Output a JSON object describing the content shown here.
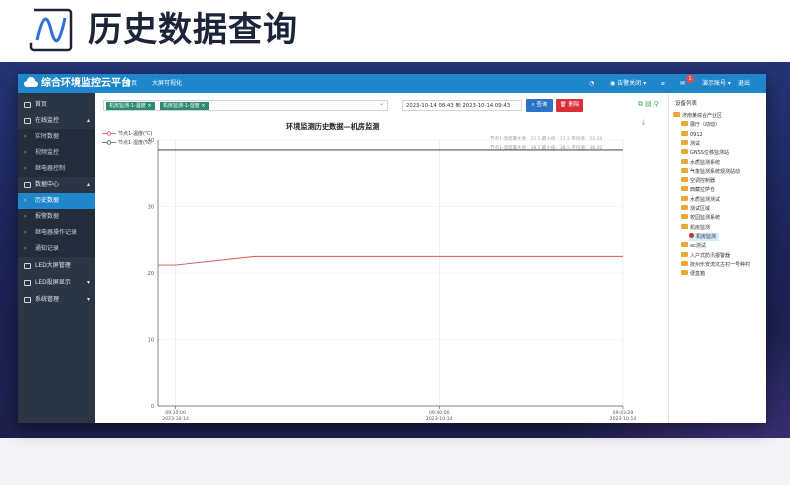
{
  "hero": {
    "title": "历史数据查询"
  },
  "topbar": {
    "app_title": "综合环境监控云平台",
    "nav": [
      "首页",
      "大屏可视化"
    ],
    "right": {
      "alarm_close": "告警关闭",
      "badge": "1",
      "account": "演示账号",
      "logout": "退出"
    }
  },
  "sidebar": {
    "items": [
      {
        "label": "首页",
        "type": "top"
      },
      {
        "label": "在线监控",
        "type": "top"
      },
      {
        "label": "实时数据",
        "type": "sub"
      },
      {
        "label": "视频监控",
        "type": "sub"
      },
      {
        "label": "继电器控制",
        "type": "sub"
      },
      {
        "label": "数据中心",
        "type": "top"
      },
      {
        "label": "历史数据",
        "type": "sub",
        "active": true
      },
      {
        "label": "报警数据",
        "type": "sub"
      },
      {
        "label": "继电器操作记录",
        "type": "sub"
      },
      {
        "label": "通知记录",
        "type": "sub"
      },
      {
        "label": "LED大屏管理",
        "type": "top"
      },
      {
        "label": "LED投屏显示",
        "type": "top"
      },
      {
        "label": "系统管理",
        "type": "top"
      }
    ]
  },
  "filter": {
    "tags": [
      "机房监测-1-温度",
      "机房监测-1-湿度"
    ],
    "date_range": "2023-10-14 08:43 到 2023-10-14 09:43",
    "query_label": "查询",
    "delete_label": "删除"
  },
  "chart": {
    "title": "环境监测历史数据—机房监测",
    "legend": [
      "节点1-温度(℃)",
      "节点1-湿度(%)"
    ],
    "stats": [
      "节点1-温度最大值：22.5  最小值：21.2  平均值：22.24",
      "节点1-湿度最大值：38.5  最小值：38.5  平均值：38.50"
    ],
    "x_times": [
      "09:35:00",
      "09:40:00",
      "09:43:29"
    ],
    "x_dates": [
      "2023-10-14",
      "2023-10-14",
      "2023-10-14"
    ]
  },
  "chart_data": {
    "type": "line",
    "title": "环境监测历史数据—机房监测",
    "ylim": [
      0,
      40
    ],
    "yticks": [
      0,
      10,
      20,
      30,
      40
    ],
    "x": [
      "09:34:40",
      "09:35:00",
      "09:36:30",
      "09:43:29"
    ],
    "series": [
      {
        "name": "节点1-温度(℃)",
        "color": "#d9534f",
        "values": [
          21.2,
          21.2,
          22.5,
          22.5
        ]
      },
      {
        "name": "节点1-湿度(%)",
        "color": "#4a5a6a",
        "values": [
          38.5,
          38.5,
          38.5,
          38.5
        ]
      }
    ],
    "grid": true
  },
  "tree": {
    "header": "设备列表",
    "nodes": [
      {
        "label": "济南某综合产业区",
        "level": 0
      },
      {
        "label": "展厅（动动）",
        "level": 1
      },
      {
        "label": "0912",
        "level": 1
      },
      {
        "label": "测试",
        "level": 1
      },
      {
        "label": "GNSS位移监测站",
        "level": 1
      },
      {
        "label": "水质监测系统",
        "level": 1
      },
      {
        "label": "气象监测系统观测站动",
        "level": 1
      },
      {
        "label": "空调控制器",
        "level": 1
      },
      {
        "label": "西藏拉萨仓",
        "level": 1
      },
      {
        "label": "水质监测测试",
        "level": 1
      },
      {
        "label": "测试区域",
        "level": 1
      },
      {
        "label": "校园监测系统",
        "level": 1
      },
      {
        "label": "机房监测",
        "level": 1
      },
      {
        "label": "机房监测",
        "level": 2,
        "selected": true
      },
      {
        "label": "ac测试",
        "level": 1
      },
      {
        "label": "入户式防汛报警器",
        "level": 1
      },
      {
        "label": "抚州乐安流坑古村一号种村",
        "level": 1
      },
      {
        "label": "便盒箱",
        "level": 1
      }
    ]
  }
}
